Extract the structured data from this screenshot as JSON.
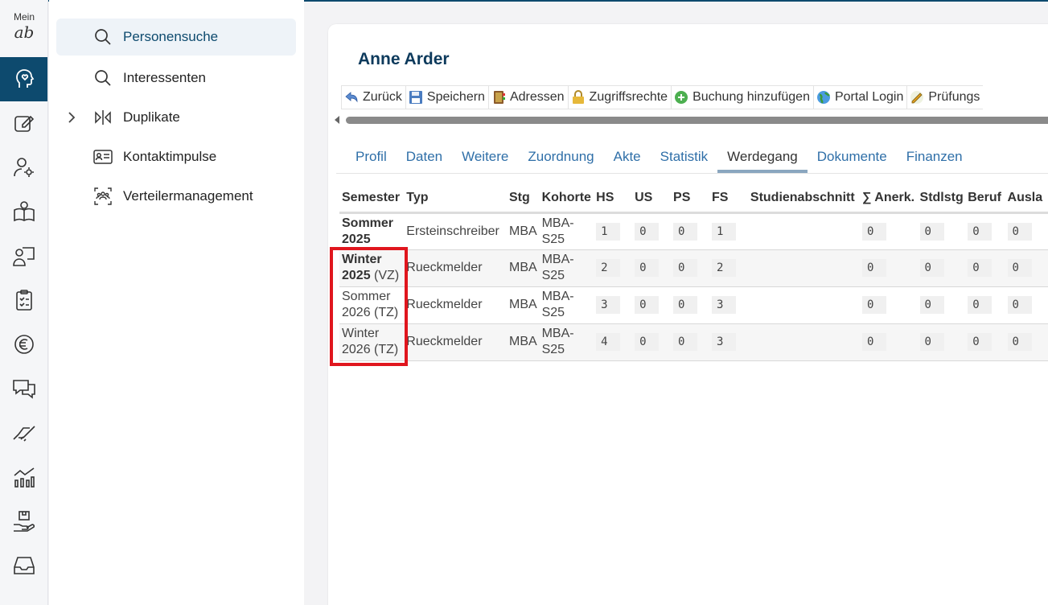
{
  "rail": {
    "logo_top": "Mein",
    "logo_glyph": "ab",
    "icons": [
      "heart-head-icon",
      "edit-icon",
      "user-settings-icon",
      "book-user-icon",
      "presenter-icon",
      "clipboard-checklist-icon",
      "euro-icon",
      "chat-icon",
      "handshake-icon",
      "chart-icon",
      "hand-box-icon",
      "inbox-icon"
    ]
  },
  "subnav": {
    "items": [
      {
        "label": "Personensuche",
        "icon": "search-icon"
      },
      {
        "label": "Interessenten",
        "icon": "search-icon"
      },
      {
        "label": "Duplikate",
        "icon": "compare-icon"
      },
      {
        "label": "Kontaktimpulse",
        "icon": "id-card-icon"
      },
      {
        "label": "Verteilermanagement",
        "icon": "group-icon"
      }
    ]
  },
  "page": {
    "title": "Anne Arder"
  },
  "toolbar": {
    "buttons": [
      "Zurück",
      "Speichern",
      "Adressen",
      "Zugriffsrechte",
      "Buchung hinzufügen",
      "Portal Login",
      "Prüfungs"
    ]
  },
  "tabs": [
    "Profil",
    "Daten",
    "Weitere",
    "Zuordnung",
    "Akte",
    "Statistik",
    "Werdegang",
    "Dokumente",
    "Finanzen"
  ],
  "active_tab": "Werdegang",
  "table": {
    "headers": [
      "Semester",
      "Typ",
      "Stg",
      "Kohorte",
      "HS",
      "US",
      "PS",
      "FS",
      "Studienabschnitt",
      "∑ Anerk.",
      "Stdlstg",
      "Beruf",
      "Ausla"
    ],
    "rows": [
      {
        "sem1": "Sommer",
        "sem2": "2025",
        "sem_suffix": "",
        "bold": true,
        "typ": "Ersteinschreiber",
        "stg": "MBA",
        "koh1": "MBA-",
        "koh2": "S25",
        "hs": "1",
        "us": "0",
        "ps": "0",
        "fs": "1",
        "abschnitt": "",
        "anerk": "0",
        "stdlstg": "0",
        "beruf": "0",
        "ausl": "0"
      },
      {
        "sem1": "Winter",
        "sem2": "2025",
        "sem_suffix": " (VZ)",
        "bold": true,
        "typ": "Rueckmelder",
        "stg": "MBA",
        "koh1": "MBA-",
        "koh2": "S25",
        "hs": "2",
        "us": "0",
        "ps": "0",
        "fs": "2",
        "abschnitt": "",
        "anerk": "0",
        "stdlstg": "0",
        "beruf": "0",
        "ausl": "0"
      },
      {
        "sem1": "Sommer",
        "sem2": "2026 (TZ)",
        "sem_suffix": "",
        "bold": false,
        "typ": "Rueckmelder",
        "stg": "MBA",
        "koh1": "MBA-",
        "koh2": "S25",
        "hs": "3",
        "us": "0",
        "ps": "0",
        "fs": "3",
        "abschnitt": "",
        "anerk": "0",
        "stdlstg": "0",
        "beruf": "0",
        "ausl": "0"
      },
      {
        "sem1": "Winter",
        "sem2": "2026 (TZ)",
        "sem_suffix": "",
        "bold": false,
        "typ": "Rueckmelder",
        "stg": "MBA",
        "koh1": "MBA-",
        "koh2": "S25",
        "hs": "4",
        "us": "0",
        "ps": "0",
        "fs": "3",
        "abschnitt": "",
        "anerk": "0",
        "stdlstg": "0",
        "beruf": "0",
        "ausl": "0"
      }
    ]
  },
  "colors": {
    "brand": "#0d4a6e",
    "link": "#2f6fa8",
    "highlight": "#e0161e"
  }
}
